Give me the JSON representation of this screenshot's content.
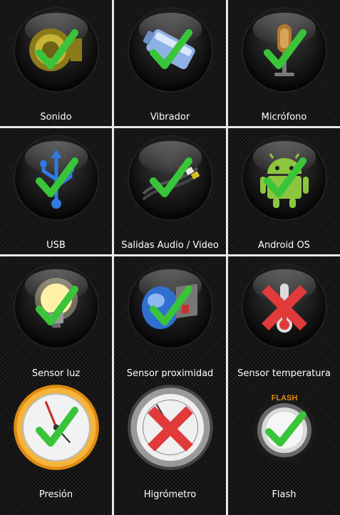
{
  "tiles": [
    {
      "label": "Sonido",
      "icon": "speaker-icon",
      "status": "check"
    },
    {
      "label": "Vibrador",
      "icon": "vibrator-icon",
      "status": "check"
    },
    {
      "label": "Micrófono",
      "icon": "microphone-icon",
      "status": "check"
    },
    {
      "label": "USB",
      "icon": "usb-icon",
      "status": "check"
    },
    {
      "label": "Salidas Audio / Video",
      "icon": "av-cable-icon",
      "status": "check"
    },
    {
      "label": "Android OS",
      "icon": "android-icon",
      "status": "check"
    },
    {
      "label": "Sensor luz",
      "icon": "light-bulb-icon",
      "status": "check"
    },
    {
      "label": "Sensor proximidad",
      "icon": "proximity-sensor-icon",
      "status": "check"
    },
    {
      "label": "Sensor temperatura",
      "icon": "thermometer-icon",
      "status": "cross"
    },
    {
      "label": "Presión",
      "icon": "barometer-icon",
      "status": "check"
    },
    {
      "label": "Higrómetro",
      "icon": "hygrometer-icon",
      "status": "cross"
    },
    {
      "label": "Flash",
      "icon": "flash-icon",
      "status": "check",
      "badge": "FLASH"
    }
  ],
  "colors": {
    "check": "#39c43a",
    "cross": "#e03a3a",
    "tile": "#0c0c0c",
    "divider": "#e9e9e9"
  }
}
